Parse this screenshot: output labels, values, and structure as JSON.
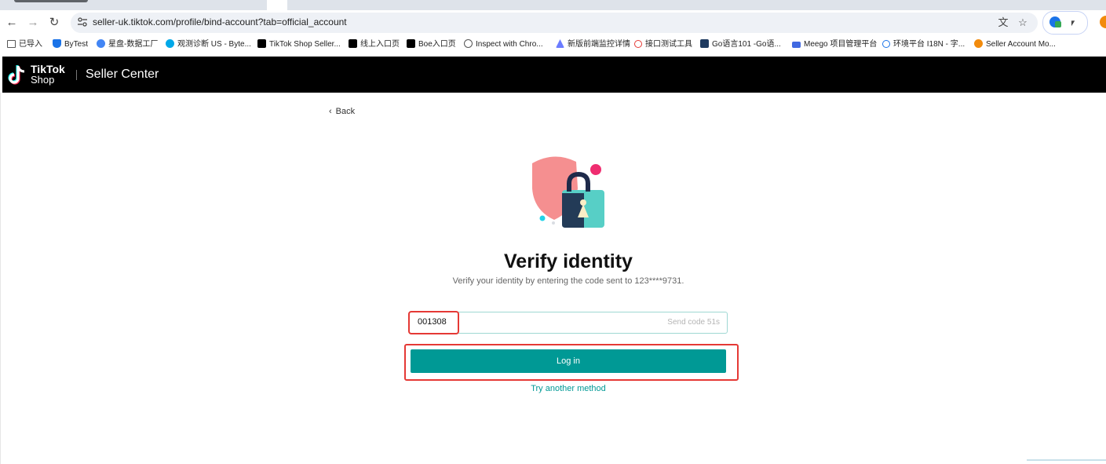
{
  "browser": {
    "url": "seller-uk.tiktok.com/profile/bind-account?tab=official_account",
    "bookmarks": [
      {
        "label": "已导入",
        "color": "#555555"
      },
      {
        "label": "ByTest",
        "color": "#1a73e8"
      },
      {
        "label": "星盘-数据工厂",
        "color": "#4285f4"
      },
      {
        "label": "观测诊断 US - Byte...",
        "color": "#00a8e8"
      },
      {
        "label": "TikTok Shop Seller...",
        "color": "#000000"
      },
      {
        "label": "线上入口页",
        "color": "#000000"
      },
      {
        "label": "Boe入口页",
        "color": "#000000"
      },
      {
        "label": "Inspect with Chro...",
        "color": "#555555"
      },
      {
        "label": "新版前端监控详情",
        "color": "#6b7cff"
      },
      {
        "label": "接口测试工具",
        "color": "#e53935"
      },
      {
        "label": "Go语言101 -Go语...",
        "color": "#1e3a5f"
      },
      {
        "label": "Meego 项目管理平台",
        "color": "#4169e1"
      },
      {
        "label": "环境平台 I18N - 字...",
        "color": "#1a73e8"
      },
      {
        "label": "Seller Account Mo...",
        "color": "#f28b0c"
      }
    ]
  },
  "header": {
    "brand_line1": "TikTok",
    "brand_line2": "Shop",
    "title": "Seller Center"
  },
  "page": {
    "back_label": "Back",
    "title": "Verify identity",
    "subtitle": "Verify your identity by entering the code sent to 123****9731.",
    "code_value": "001308",
    "send_code_label": "Send code 51s",
    "login_label": "Log in",
    "alt_method_label": "Try another method"
  },
  "colors": {
    "accent": "#009995",
    "highlight": "#e53935"
  }
}
